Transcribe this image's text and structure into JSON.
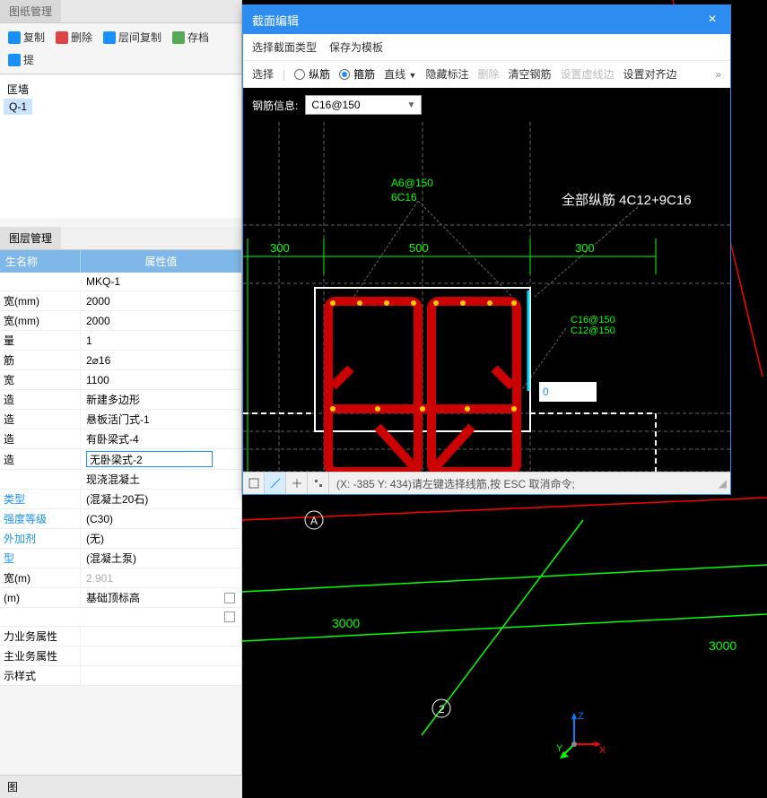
{
  "left_tabs": {
    "t1": "图纸管理"
  },
  "toolbar": {
    "copy": "复制",
    "delete": "删除",
    "layer_copy": "层间复制",
    "archive": "存档",
    "submit": "提"
  },
  "tree": {
    "root": "匡墙",
    "item": "Q-1"
  },
  "sub_tabs": {
    "t1": "图层管理"
  },
  "prop_header": {
    "name": "生名称",
    "value": "属性值"
  },
  "props": [
    {
      "n": "",
      "v": "MKQ-1"
    },
    {
      "n": "宽(mm)",
      "v": "2000"
    },
    {
      "n": "宽(mm)",
      "v": "2000"
    },
    {
      "n": "量",
      "v": "1"
    },
    {
      "n": "筋",
      "v": "2⌀16"
    },
    {
      "n": "宽",
      "v": "1100"
    },
    {
      "n": "造",
      "v": "新建多边形"
    },
    {
      "n": "造",
      "v": "悬板活门式-1"
    },
    {
      "n": "造",
      "v": "有卧梁式-4"
    },
    {
      "n": "造",
      "v": "无卧梁式-2",
      "edit": true
    },
    {
      "n": "",
      "v": "现浇混凝土"
    },
    {
      "n": "类型",
      "v": "(混凝土20石)",
      "blue": true
    },
    {
      "n": "强度等级",
      "v": "(C30)",
      "blue": true
    },
    {
      "n": "外加剂",
      "v": "(无)",
      "blue": true
    },
    {
      "n": "型",
      "v": "(混凝土泵)",
      "blue": true
    },
    {
      "n": "宽(m)",
      "v": "2.901",
      "gray": true
    },
    {
      "n": "(m)",
      "v": "基础顶标高",
      "chk": true
    },
    {
      "n": "",
      "v": "",
      "chk": true
    },
    {
      "n": "力业务属性",
      "v": ""
    },
    {
      "n": "主业务属性",
      "v": ""
    },
    {
      "n": "示样式",
      "v": ""
    }
  ],
  "bottom_tab": "图",
  "dialog": {
    "title": "截面编辑",
    "row1": {
      "a1": "选择截面类型",
      "a2": "保存为模板"
    },
    "row2": {
      "select": "选择",
      "r1": "纵筋",
      "r2": "箍筋",
      "line": "直线",
      "hide": "隐藏标注",
      "del": "删除",
      "clear": "清空钢筋",
      "vlines": "设置虚线边",
      "align": "设置对齐边"
    },
    "rebar_label": "钢筋信息:",
    "rebar_value": "C16@150",
    "canvas_text": {
      "t1": "A6@150",
      "t2": "6C16",
      "t3": "全部纵筋 4C12+9C16",
      "d300a": "300",
      "d500": "500",
      "d300b": "300",
      "line1": "C16@150",
      "line2": "C12@150"
    },
    "input_val": "0",
    "status": {
      "coord": "(X: -385 Y: 434)请左键选择线筋,按 ESC 取消命令;"
    }
  },
  "main": {
    "dim1": "3000",
    "dim2": "3000",
    "markA": "A",
    "mark2": "2",
    "axis": {
      "x": "X",
      "y": "Y",
      "z": "Z"
    }
  }
}
